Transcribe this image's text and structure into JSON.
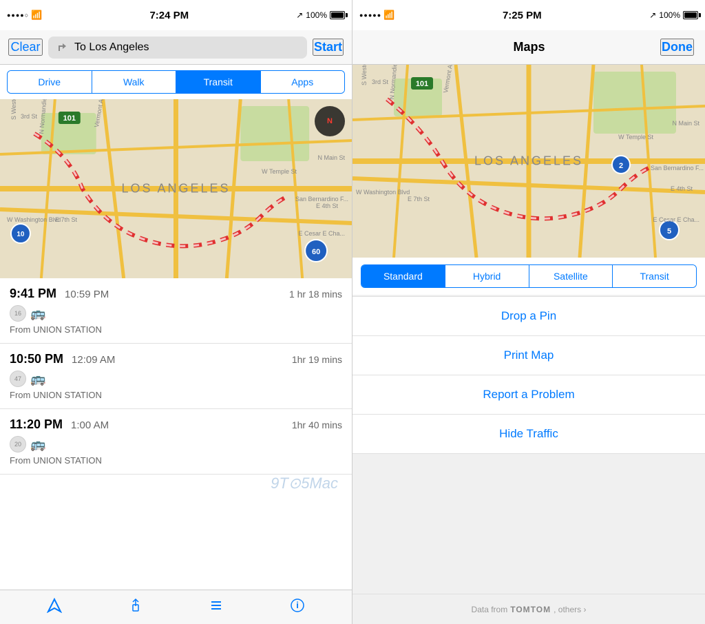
{
  "left": {
    "statusBar": {
      "time": "7:24 PM",
      "battery": "100%",
      "signal": "●●●●○"
    },
    "nav": {
      "clearLabel": "Clear",
      "destination": "To Los Angeles",
      "startLabel": "Start"
    },
    "tabs": [
      {
        "id": "drive",
        "label": "Drive",
        "active": false
      },
      {
        "id": "walk",
        "label": "Walk",
        "active": false
      },
      {
        "id": "transit",
        "label": "Transit",
        "active": true
      },
      {
        "id": "apps",
        "label": "Apps",
        "active": false
      }
    ],
    "mapLabel": "LOS ANGELES",
    "routes": [
      {
        "depart": "9:41 PM",
        "arrive": "10:59 PM",
        "duration": "1 hr 18 mins",
        "buses": [
          "16",
          "🚌"
        ],
        "from": "From UNION STATION"
      },
      {
        "depart": "10:50 PM",
        "arrive": "12:09 AM",
        "duration": "1hr 19 mins",
        "buses": [
          "47",
          "🚌"
        ],
        "from": "From UNION STATION"
      },
      {
        "depart": "11:20 PM",
        "arrive": "1:00 AM",
        "duration": "1hr 40 mins",
        "buses": [
          "20",
          "🚌"
        ],
        "from": "From UNION STATION"
      }
    ],
    "toolbar": {
      "locationIcon": "↗",
      "shareIcon": "⬆",
      "listIcon": "≡",
      "infoIcon": "ⓘ"
    }
  },
  "right": {
    "statusBar": {
      "time": "7:25 PM",
      "battery": "100%",
      "signal": "●●●●●"
    },
    "nav": {
      "title": "Maps",
      "doneLabel": "Done"
    },
    "mapLabel": "LOS ANGELES",
    "mapTypes": [
      {
        "id": "standard",
        "label": "Standard",
        "active": true
      },
      {
        "id": "hybrid",
        "label": "Hybrid",
        "active": false
      },
      {
        "id": "satellite",
        "label": "Satellite",
        "active": false
      },
      {
        "id": "transit",
        "label": "Transit",
        "active": false
      }
    ],
    "actions": [
      {
        "id": "drop-pin",
        "label": "Drop a Pin"
      },
      {
        "id": "print-map",
        "label": "Print Map"
      },
      {
        "id": "report-problem",
        "label": "Report a Problem"
      },
      {
        "id": "hide-traffic",
        "label": "Hide Traffic"
      }
    ],
    "footer": {
      "text": "Data from",
      "source": "TOMTOM",
      "others": ", others ›"
    }
  }
}
